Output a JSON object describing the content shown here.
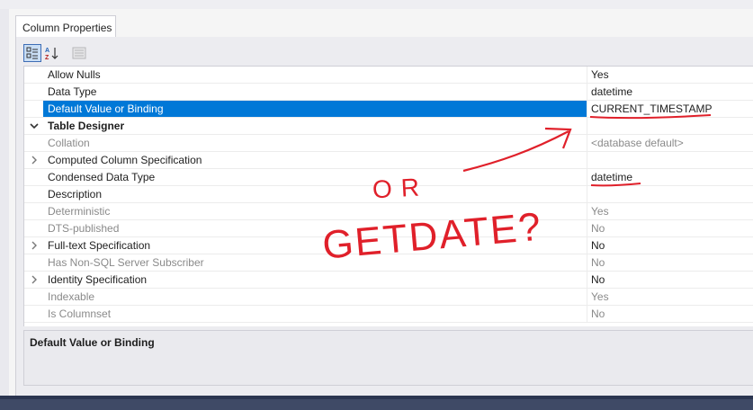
{
  "tab": {
    "label": "Column Properties"
  },
  "toolbar": {
    "categorized_icon": "categorized-icon",
    "alphabetical_icon": "alphabetical-sort-icon",
    "property_pages_icon": "property-pages-icon"
  },
  "rows": [
    {
      "name": "Allow Nulls",
      "value": "Yes"
    },
    {
      "name": "Data Type",
      "value": "datetime"
    },
    {
      "name": "Default Value or Binding",
      "value": "CURRENT_TIMESTAMP"
    },
    {
      "name": "Table Designer",
      "value": ""
    },
    {
      "name": "Collation",
      "value": "<database default>"
    },
    {
      "name": "Computed Column Specification",
      "value": ""
    },
    {
      "name": "Condensed Data Type",
      "value": "datetime"
    },
    {
      "name": "Description",
      "value": ""
    },
    {
      "name": "Deterministic",
      "value": "Yes"
    },
    {
      "name": "DTS-published",
      "value": "No"
    },
    {
      "name": "Full-text Specification",
      "value": "No"
    },
    {
      "name": "Has Non-SQL Server Subscriber",
      "value": "No"
    },
    {
      "name": "Identity Specification",
      "value": "No"
    },
    {
      "name": "Indexable",
      "value": "Yes"
    },
    {
      "name": "Is Columnset",
      "value": "No"
    }
  ],
  "description": {
    "title": "Default Value or Binding"
  },
  "annotation": {
    "or_text": "OR",
    "getdate_text": "GETDATE?"
  },
  "colors": {
    "selection": "#0078d7",
    "annotation": "#e0202a"
  }
}
